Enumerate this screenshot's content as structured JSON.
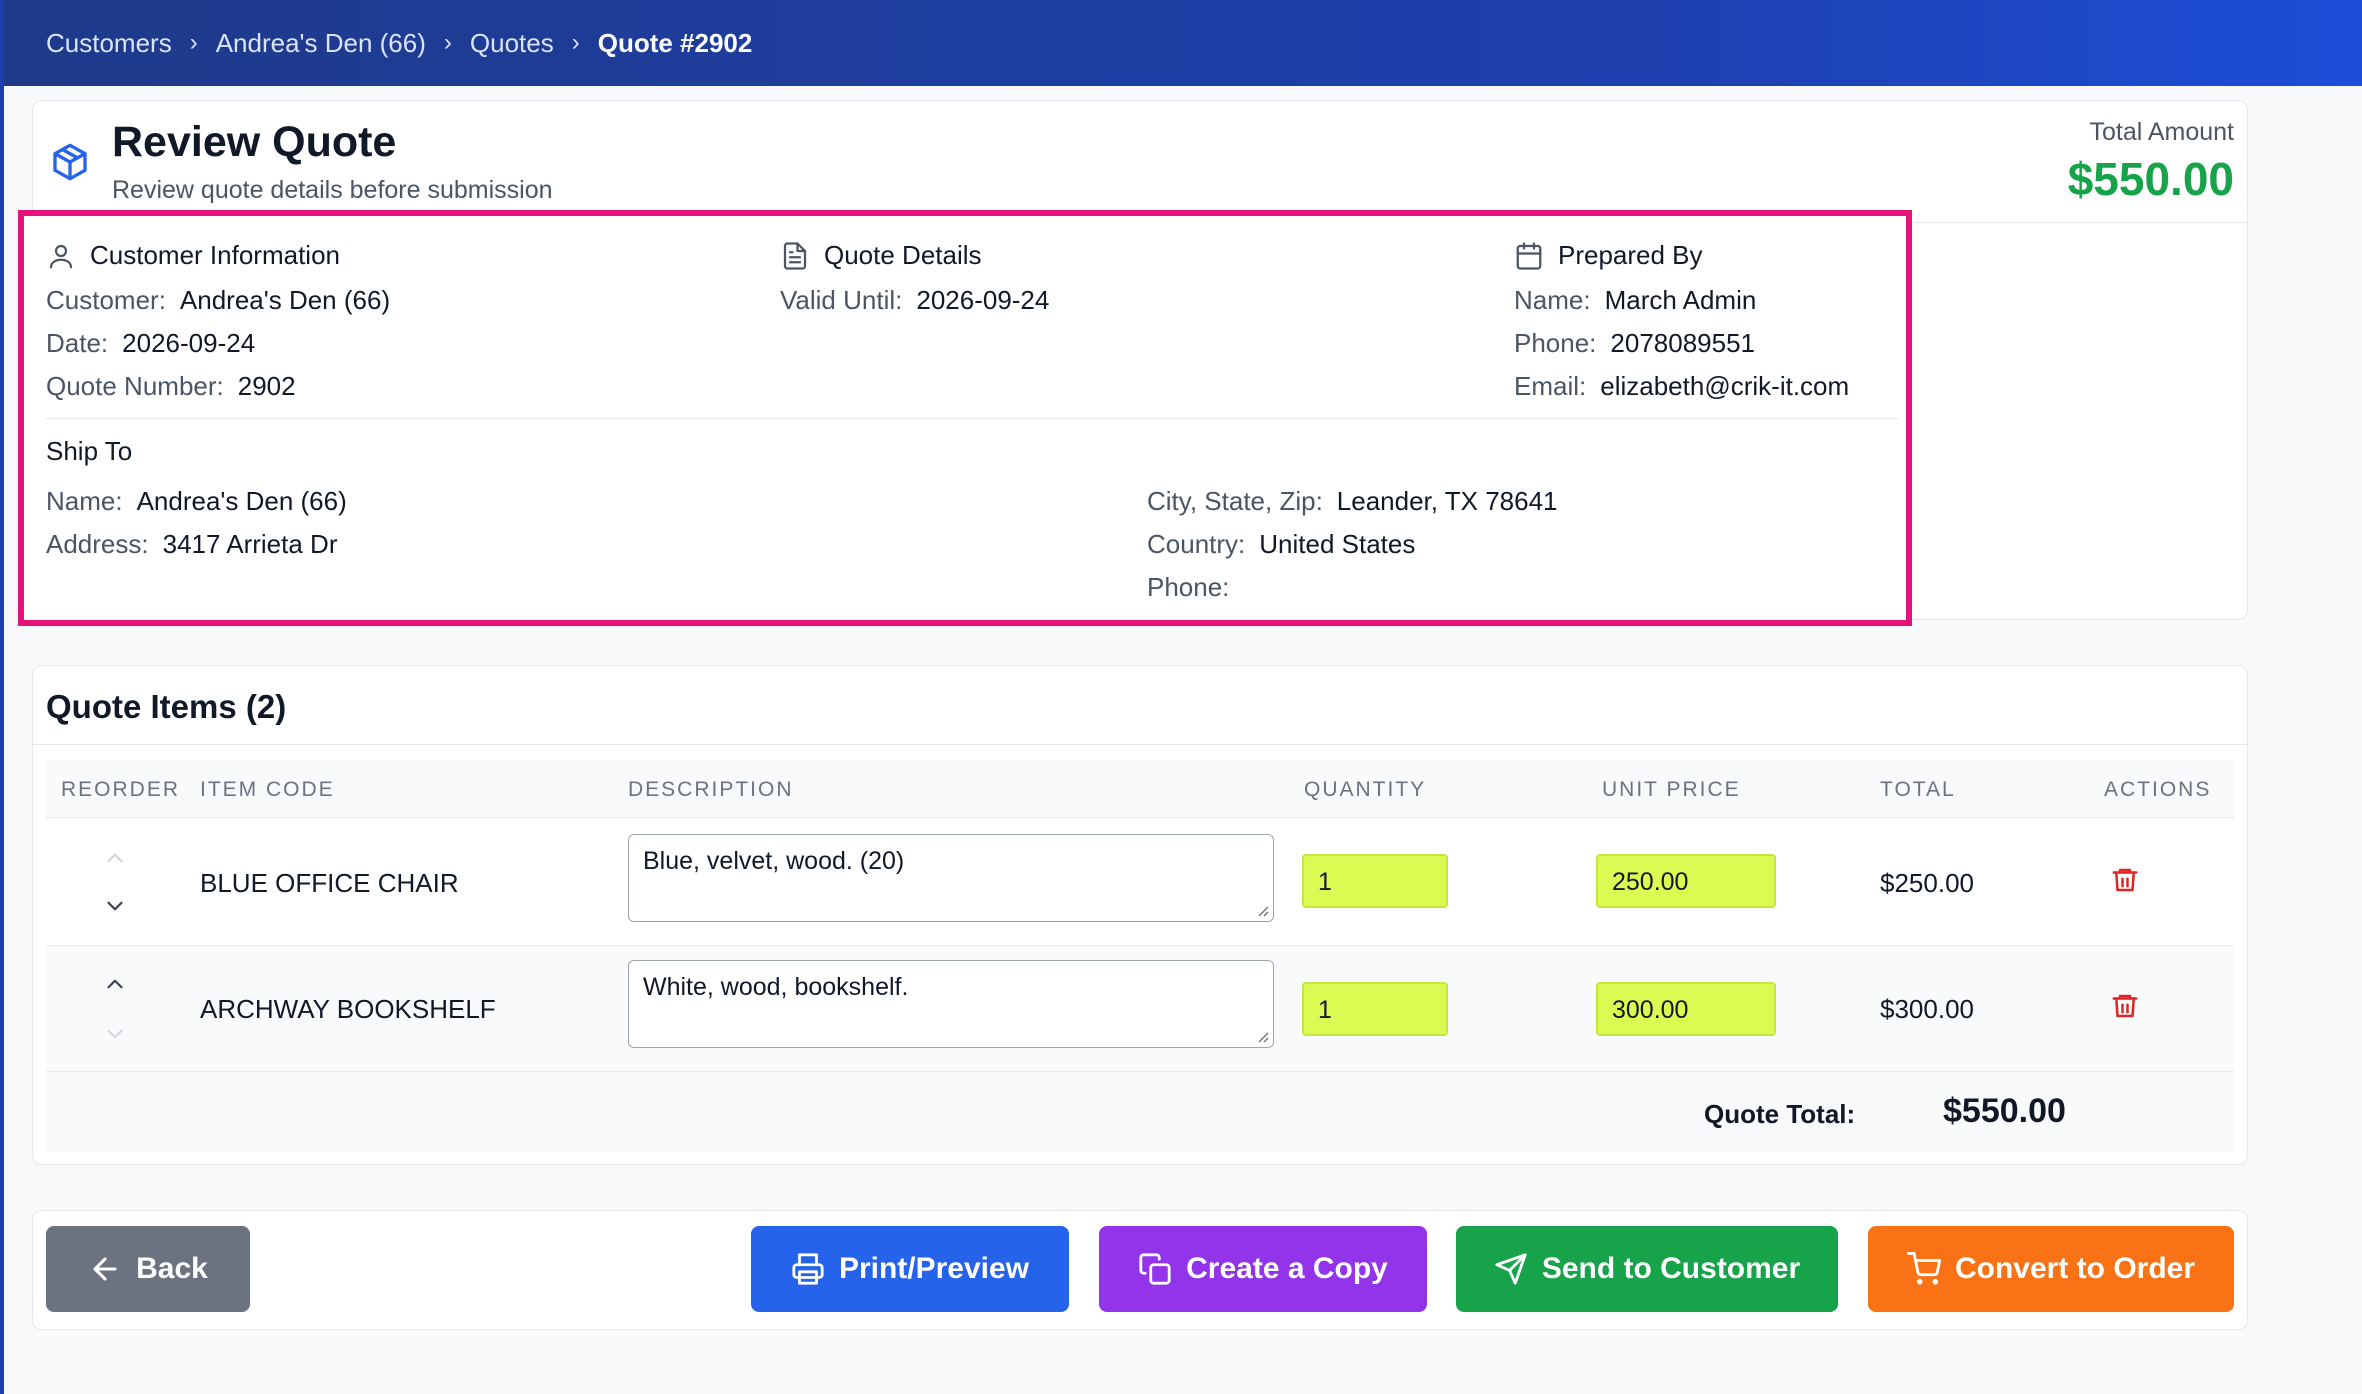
{
  "breadcrumb": {
    "items": [
      "Customers",
      "Andrea's Den (66)",
      "Quotes",
      "Quote #2902"
    ],
    "separator": "›"
  },
  "header": {
    "icon": "package-icon",
    "title": "Review Quote",
    "subtitle": "Review quote details before submission",
    "total_label": "Total Amount",
    "total_amount": "$550.00"
  },
  "customer_info": {
    "heading": "Customer Information",
    "icon": "user-icon",
    "customer_label": "Customer:",
    "customer_value": "Andrea's Den (66)",
    "date_label": "Date:",
    "date_value": "2026-09-24",
    "quote_number_label": "Quote Number:",
    "quote_number_value": "2902"
  },
  "quote_details": {
    "heading": "Quote Details",
    "icon": "document-icon",
    "valid_until_label": "Valid Until:",
    "valid_until_value": "2026-09-24"
  },
  "prepared_by": {
    "heading": "Prepared By",
    "icon": "calendar-icon",
    "name_label": "Name:",
    "name_value": "March Admin",
    "phone_label": "Phone:",
    "phone_value": "2078089551",
    "email_label": "Email:",
    "email_value": "elizabeth@crik-it.com"
  },
  "ship_to": {
    "heading": "Ship To",
    "name_label": "Name:",
    "name_value": "Andrea's Den (66)",
    "address_label": "Address:",
    "address_value": "3417 Arrieta Dr",
    "city_label": "City, State, Zip:",
    "city_value": "Leander, TX 78641",
    "country_label": "Country:",
    "country_value": "United States",
    "phone_label": "Phone:",
    "phone_value": ""
  },
  "items": {
    "title": "Quote Items (2)",
    "columns": [
      "REORDER",
      "ITEM CODE",
      "DESCRIPTION",
      "QUANTITY",
      "UNIT PRICE",
      "TOTAL",
      "ACTIONS"
    ],
    "rows": [
      {
        "code": "BLUE OFFICE CHAIR",
        "description": "Blue, velvet, wood. (20)",
        "quantity": "1",
        "unit_price": "250.00",
        "total": "$250.00"
      },
      {
        "code": "ARCHWAY BOOKSHELF",
        "description": "White, wood, bookshelf.",
        "quantity": "1",
        "unit_price": "300.00",
        "total": "$300.00"
      }
    ],
    "quote_total_label": "Quote Total:",
    "quote_total_value": "$550.00"
  },
  "actions": {
    "back": "Back",
    "print": "Print/Preview",
    "copy": "Create a Copy",
    "send": "Send to Customer",
    "convert": "Convert to Order"
  },
  "colors": {
    "topbar": "#1e40af",
    "highlight_border": "#e8137a",
    "total_green": "#16a34a",
    "input_highlight": "#d9fb52",
    "btn_back": "#6b7280",
    "btn_print": "#2563eb",
    "btn_copy": "#9333ea",
    "btn_send": "#16a34a",
    "btn_convert": "#f97316",
    "trash_red": "#dc2626"
  }
}
